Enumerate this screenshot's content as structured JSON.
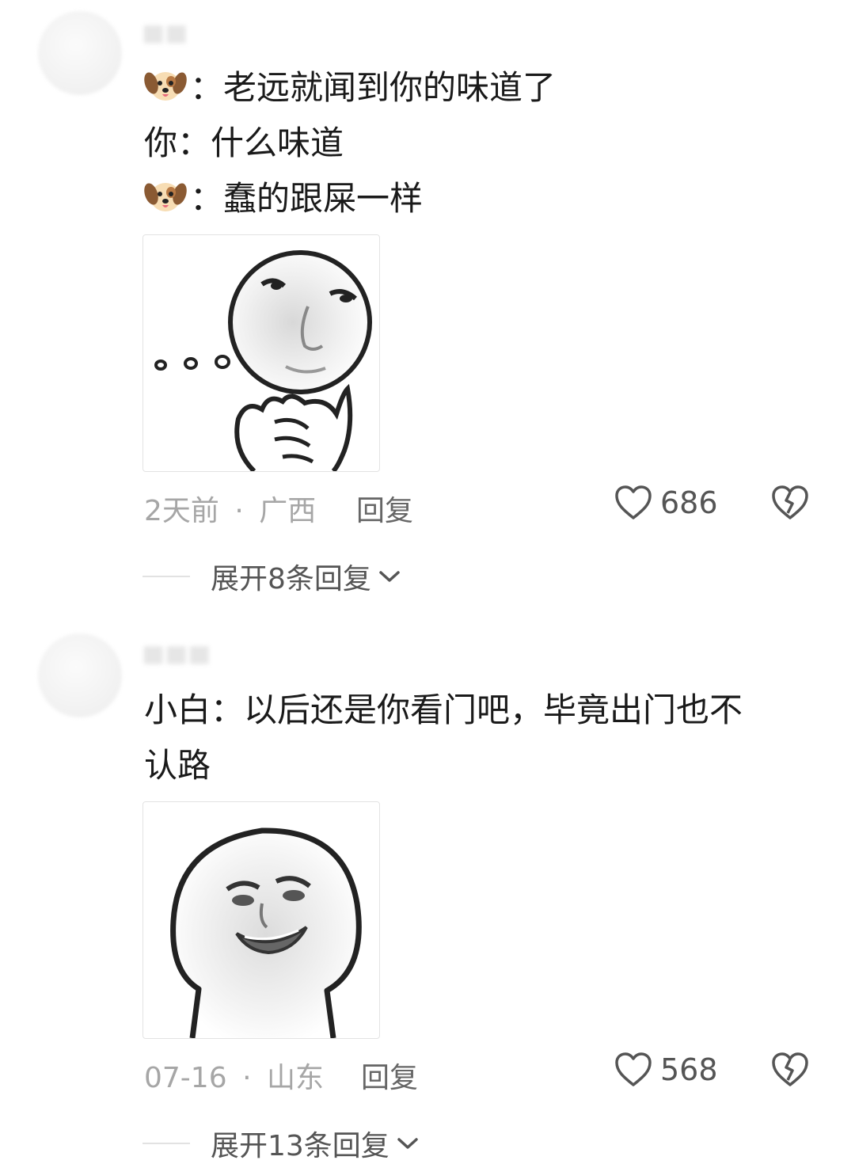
{
  "comments": [
    {
      "lines": [
        {
          "emoji": "dog-face",
          "text": "：老远就闻到你的味道了"
        },
        {
          "emoji": null,
          "text": "你：什么味道"
        },
        {
          "emoji": "dog-face",
          "text": "：蠢的跟屎一样"
        }
      ],
      "sticker": "thinking-face-meme",
      "time": "2天前",
      "separator": "·",
      "location": "广西",
      "reply_label": "回复",
      "likes": "686",
      "expand_label": "展开8条回复"
    },
    {
      "lines": [
        {
          "emoji": null,
          "text": "小白：以后还是你看门吧，毕竟出门也不"
        },
        {
          "emoji": null,
          "text": "认路"
        }
      ],
      "sticker": "smug-face-meme",
      "time": "07-16",
      "separator": "·",
      "location": "山东",
      "reply_label": "回复",
      "likes": "568",
      "expand_label": "展开13条回复"
    }
  ],
  "icons": {
    "like": "heart-outline-icon",
    "dislike": "broken-heart-icon",
    "expand": "chevron-down-icon"
  },
  "colors": {
    "text_primary": "#1a1a1a",
    "text_meta": "#a6a6a6",
    "text_action": "#555555"
  }
}
